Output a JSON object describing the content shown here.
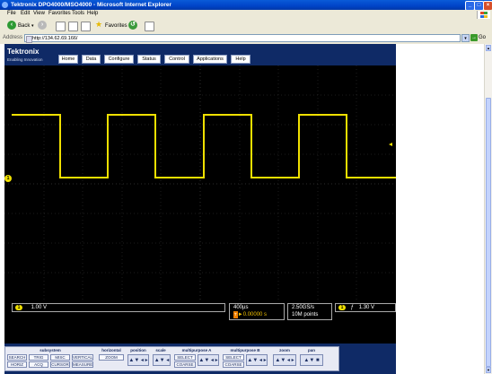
{
  "window": {
    "title": "Tektronix DPO4000/MSO4000 - Microsoft Internet Explorer"
  },
  "menu": [
    "File",
    "Edit",
    "View",
    "Favorites",
    "Tools",
    "Help"
  ],
  "toolbar": {
    "back": "Back",
    "favorites": "Favorites"
  },
  "address": {
    "label": "Address",
    "url": "http://134.62.69.166/",
    "go": "Go"
  },
  "brand": {
    "name": "Tektronix",
    "tagline": "Enabling Innovation"
  },
  "nav": [
    "Home",
    "Data",
    "Configure",
    "Status",
    "Control",
    "Applications",
    "Help"
  ],
  "scope": {
    "channel_badge": "1",
    "ch1_scale": "1.00 V",
    "timebase": "400µs",
    "delay": "►0.00000 s",
    "sample_rate": "2.50GS/s",
    "record_length": "10M points",
    "trigger_level": "1.30 V",
    "trigger_slope": "ƒ",
    "colors": {
      "trace": "#f0e000",
      "grid": "#3a3a3a",
      "background": "#000000"
    }
  },
  "controls": {
    "subsystem": {
      "title": "subsystem",
      "buttons": [
        "SEARCH",
        "TRIG",
        "MISC",
        "VERTICAL",
        "HORIZ",
        "ACQ",
        "CURSOR",
        "MEASURE"
      ]
    },
    "horizontal": {
      "title": "horizontal",
      "buttons": [
        "ZOOM"
      ]
    },
    "position": {
      "title": "position"
    },
    "scale": {
      "title": "scale"
    },
    "multipurpose_a": {
      "title": "multipurpose A",
      "buttons": [
        "SELECT",
        "COARSE"
      ]
    },
    "multipurpose_b": {
      "title": "multipurpose B",
      "buttons": [
        "SELECT",
        "COARSE"
      ]
    },
    "zoom": {
      "title": "zoom"
    },
    "pan": {
      "title": "pan"
    }
  }
}
